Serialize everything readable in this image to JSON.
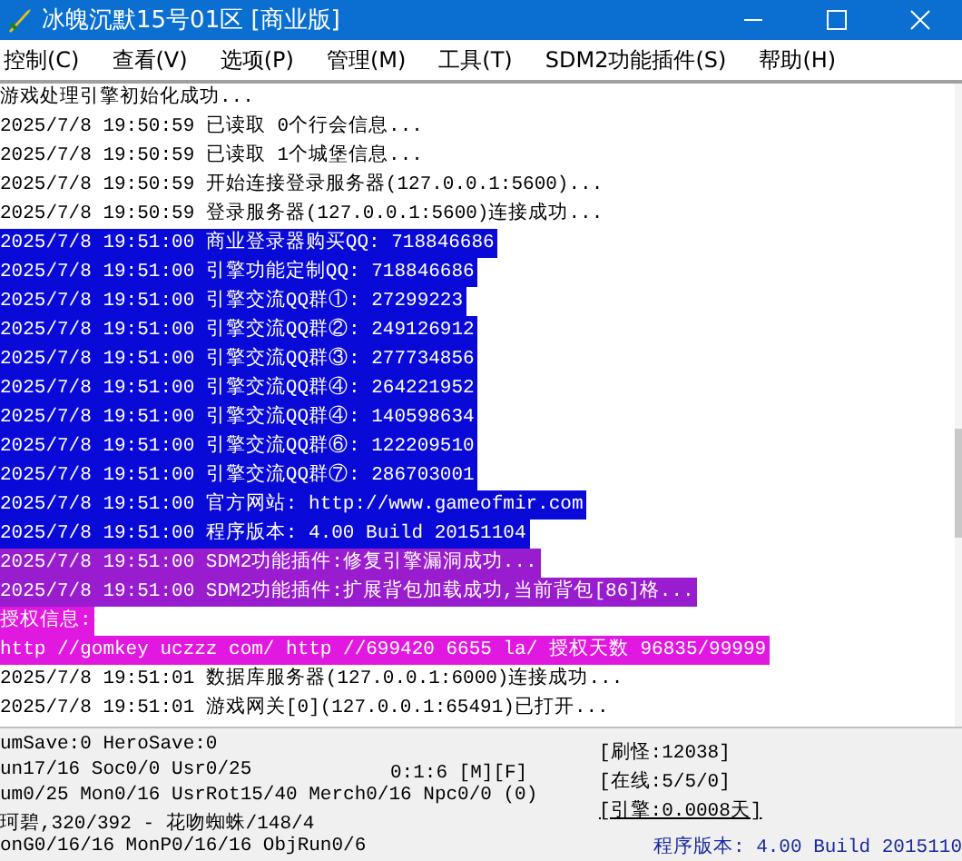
{
  "window": {
    "title": "冰魄沉默15号01区 [商业版]"
  },
  "menu": [
    "控制(C)",
    "查看(V)",
    "选项(P)",
    "管理(M)",
    "工具(T)",
    "SDM2功能插件(S)",
    "帮助(H)"
  ],
  "log": [
    {
      "kind": "plain",
      "text": "游戏处理引擎初始化成功..."
    },
    {
      "kind": "plain",
      "text": "2025/7/8 19:50:59 已读取 0个行会信息..."
    },
    {
      "kind": "plain",
      "text": "2025/7/8 19:50:59 已读取 1个城堡信息..."
    },
    {
      "kind": "plain",
      "text": "2025/7/8 19:50:59 开始连接登录服务器(127.0.0.1:5600)..."
    },
    {
      "kind": "plain",
      "text": "2025/7/8 19:50:59 登录服务器(127.0.0.1:5600)连接成功..."
    },
    {
      "kind": "info",
      "text": "2025/7/8 19:51:00 商业登录器购买QQ: 718846686"
    },
    {
      "kind": "info",
      "text": "2025/7/8 19:51:00 引擎功能定制QQ: 718846686"
    },
    {
      "kind": "info",
      "text": "2025/7/8 19:51:00 引擎交流QQ群①: 27299223"
    },
    {
      "kind": "info",
      "text": "2025/7/8 19:51:00 引擎交流QQ群②: 249126912"
    },
    {
      "kind": "info",
      "text": "2025/7/8 19:51:00 引擎交流QQ群③: 277734856"
    },
    {
      "kind": "info",
      "text": "2025/7/8 19:51:00 引擎交流QQ群④: 264221952"
    },
    {
      "kind": "info",
      "text": "2025/7/8 19:51:00 引擎交流QQ群④: 140598634"
    },
    {
      "kind": "info",
      "text": "2025/7/8 19:51:00 引擎交流QQ群⑥: 122209510"
    },
    {
      "kind": "info",
      "text": "2025/7/8 19:51:00 引擎交流QQ群⑦: 286703001"
    },
    {
      "kind": "info",
      "text": "2025/7/8 19:51:00 官方网站: http://www.gameofmir.com"
    },
    {
      "kind": "info",
      "text": "2025/7/8 19:51:00 程序版本: 4.00 Build 20151104"
    },
    {
      "kind": "plugin",
      "text": "2025/7/8 19:51:00 SDM2功能插件:修复引擎漏洞成功..."
    },
    {
      "kind": "plugin",
      "text": "2025/7/8 19:51:00 SDM2功能插件:扩展背包加载成功,当前背包[86]格..."
    },
    {
      "kind": "license",
      "text": "授权信息:"
    },
    {
      "kind": "license",
      "text": "http //gomkey uczzz com/ http //699420 6655 la/ 授权天数 96835/99999"
    },
    {
      "kind": "plain",
      "text": "2025/7/8 19:51:01 数据库服务器(127.0.0.1:6000)连接成功..."
    },
    {
      "kind": "plain",
      "text": "2025/7/8 19:51:01 游戏网关[0](127.0.0.1:65491)已打开..."
    }
  ],
  "status": {
    "lines": [
      "umSave:0 HeroSave:0",
      "un17/16 Soc0/0 Usr0/25",
      "um0/25 Mon0/16 UsrRot15/40 Merch0/16 Npc0/0 (0)",
      "珂碧,320/392 - 花吻蜘蛛/148/4",
      "onG0/16/16 MonP0/16/16 ObjRun0/6"
    ],
    "clock": "0:1:6 [M][F]",
    "counters": [
      "[刷怪:12038]",
      "[在线:5/5/0]"
    ],
    "engine": "[引擎:0.0008天]",
    "version": "程序版本: 4.00 Build 2015110"
  }
}
